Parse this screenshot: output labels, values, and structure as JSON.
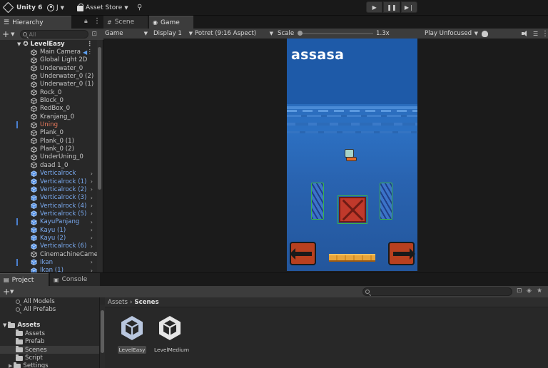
{
  "toolbar": {
    "app_title": "Unity 6",
    "account": "J",
    "asset_store": "Asset Store",
    "play_icons": [
      "play-icon",
      "pause-icon",
      "step-icon"
    ]
  },
  "hierarchy": {
    "tab": "Hierarchy",
    "search_placeholder": "All",
    "scene": "LevelEasy",
    "items": [
      {
        "label": "Main Camera",
        "style": "normal"
      },
      {
        "label": "Global Light 2D",
        "style": "normal"
      },
      {
        "label": "Underwater_0",
        "style": "normal"
      },
      {
        "label": "Underwater_0 (2)",
        "style": "normal"
      },
      {
        "label": "Underwater_0 (1)",
        "style": "normal"
      },
      {
        "label": "Rock_0",
        "style": "normal"
      },
      {
        "label": "Block_0",
        "style": "normal"
      },
      {
        "label": "RedBox_0",
        "style": "normal"
      },
      {
        "label": "Kranjang_0",
        "style": "normal"
      },
      {
        "label": "Uning",
        "style": "red"
      },
      {
        "label": "Plank_0",
        "style": "normal"
      },
      {
        "label": "Plank_0 (1)",
        "style": "normal"
      },
      {
        "label": "Plank_0 (2)",
        "style": "normal"
      },
      {
        "label": "UnderUning_0",
        "style": "normal"
      },
      {
        "label": "daad 1_0",
        "style": "normal"
      },
      {
        "label": "Verticalrock",
        "style": "blue"
      },
      {
        "label": "Verticalrock (1)",
        "style": "blue"
      },
      {
        "label": "Verticalrock (2)",
        "style": "blue"
      },
      {
        "label": "Verticalrock (3)",
        "style": "blue"
      },
      {
        "label": "Verticalrock (4)",
        "style": "blue"
      },
      {
        "label": "Verticalrock (5)",
        "style": "blue"
      },
      {
        "label": "KayuPanjang",
        "style": "blue"
      },
      {
        "label": "Kayu (1)",
        "style": "blue"
      },
      {
        "label": "Kayu (2)",
        "style": "blue"
      },
      {
        "label": "Verticalrock (6)",
        "style": "blue"
      },
      {
        "label": "CinemachineCamer",
        "style": "normal"
      },
      {
        "label": "Ikan",
        "style": "blue"
      },
      {
        "label": "Ikan (1)",
        "style": "blue"
      }
    ]
  },
  "tabs": {
    "scene": "Scene",
    "game": "Game"
  },
  "game_bar": {
    "mode": "Game",
    "display": "Display 1",
    "aspect": "Potret (9:16 Aspect)",
    "scale_label": "Scale",
    "scale_value": "1.3x",
    "play_mode": "Play Unfocused"
  },
  "game_view": {
    "title_text": "assasa"
  },
  "project": {
    "tab": "Project",
    "console_tab": "Console",
    "tree": [
      {
        "label": "All Models",
        "kind": "search"
      },
      {
        "label": "All Prefabs",
        "kind": "search"
      },
      {
        "label": "Assets",
        "kind": "root"
      },
      {
        "label": "Assets",
        "kind": "folder"
      },
      {
        "label": "Prefab",
        "kind": "folder"
      },
      {
        "label": "Scenes",
        "kind": "folder"
      },
      {
        "label": "Script",
        "kind": "folder"
      },
      {
        "label": "Settings",
        "kind": "folder"
      }
    ],
    "breadcrumb": [
      "Assets",
      "Scenes"
    ],
    "assets": [
      {
        "label": "LevelEasy",
        "selected": true
      },
      {
        "label": "LevelMedium",
        "selected": false
      }
    ]
  }
}
